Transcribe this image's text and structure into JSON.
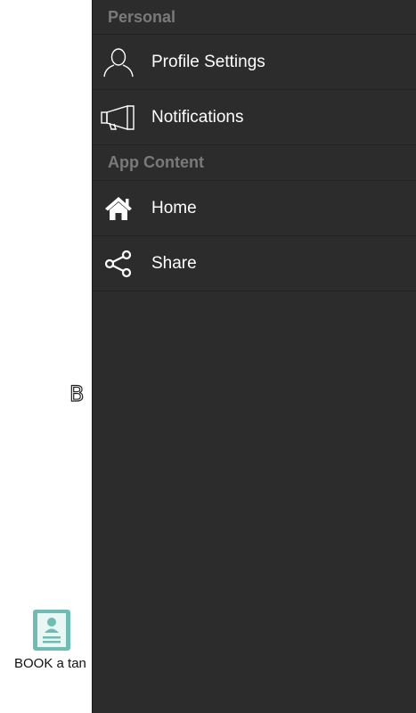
{
  "background_app": {
    "partial_letter": "B",
    "book_button_label": "BOOK a tan",
    "accent_color": "#6dbdb4"
  },
  "drawer": {
    "sections": [
      {
        "header": "Personal",
        "items": [
          {
            "label": "Profile Settings",
            "icon": "user-outline-icon"
          },
          {
            "label": "Notifications",
            "icon": "megaphone-icon"
          }
        ]
      },
      {
        "header": "App Content",
        "items": [
          {
            "label": "Home",
            "icon": "home-icon"
          },
          {
            "label": "Share",
            "icon": "share-icon"
          }
        ]
      }
    ],
    "background_color": "#2c2c2c"
  }
}
